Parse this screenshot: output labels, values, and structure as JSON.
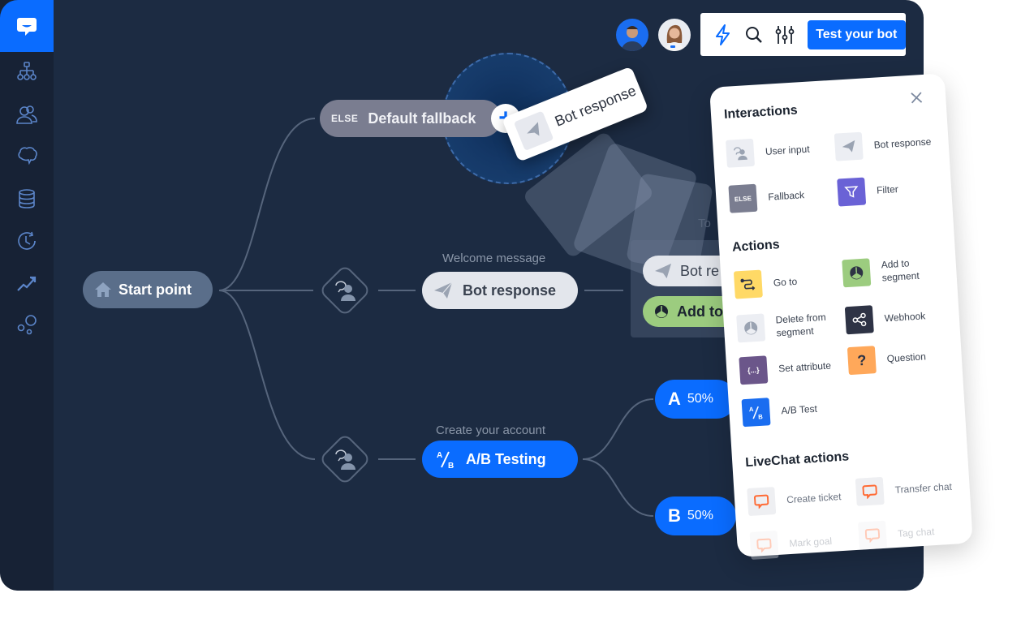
{
  "sidebar": {
    "logo": "chat-logo-icon",
    "items": [
      {
        "icon": "sitemap-icon",
        "label": "Stories"
      },
      {
        "icon": "users-icon",
        "label": "Audience"
      },
      {
        "icon": "brain-icon",
        "label": "Training"
      },
      {
        "icon": "database-icon",
        "label": "Data"
      },
      {
        "icon": "history-icon",
        "label": "History"
      },
      {
        "icon": "trend-icon",
        "label": "Reports"
      },
      {
        "icon": "integrations-icon",
        "label": "Integrations"
      }
    ]
  },
  "toolbar": {
    "avatars": [
      "user-avatar-1",
      "user-avatar-2"
    ],
    "icons": [
      "lightning-icon",
      "search-icon",
      "sliders-icon"
    ],
    "test_label": "Test your bot"
  },
  "flow": {
    "start_label": "Start point",
    "fallback_tag": "ELSE",
    "fallback_label": "Default fallback",
    "welcome_caption": "Welcome message",
    "bot_response_label": "Bot response",
    "create_caption": "Create your account",
    "ab_label": "A/B Testing",
    "ab_a": {
      "letter": "A",
      "percent": "50%"
    },
    "ab_b": {
      "letter": "B",
      "percent": "50%"
    },
    "drag_card_label": "Bot response",
    "to_caption": "To",
    "group_items": [
      "Bot re",
      "Add to"
    ],
    "plus": "+"
  },
  "panel": {
    "interactions_title": "Interactions",
    "interactions": [
      {
        "label": "User input",
        "icon": "user-input-icon",
        "color": "#eceef3"
      },
      {
        "label": "Bot response",
        "icon": "paper-plane-icon",
        "color": "#eceef3"
      },
      {
        "label": "Fallback",
        "icon": "else-icon",
        "tag": "ELSE",
        "color": "#7a7d90"
      },
      {
        "label": "Filter",
        "icon": "filter-icon",
        "color": "#6a62d6"
      }
    ],
    "actions_title": "Actions",
    "actions": [
      {
        "label": "Go to",
        "icon": "goto-icon",
        "color": "#ffd966"
      },
      {
        "label": "Add to segment",
        "icon": "pie-icon",
        "color": "#9ccc7f"
      },
      {
        "label": "Delete from segment",
        "icon": "pie-icon",
        "color": "#eceef3"
      },
      {
        "label": "Webhook",
        "icon": "share-icon",
        "color": "#2e3345"
      },
      {
        "label": "Set attribute",
        "icon": "braces-icon",
        "tag": "{...}",
        "color": "#6b568a"
      },
      {
        "label": "Question",
        "icon": "question-icon",
        "tag": "?",
        "color": "#ffa85a"
      },
      {
        "label": "A/B Test",
        "icon": "ab-icon",
        "color": "#1a6df0"
      }
    ],
    "livechat_title": "LiveChat actions",
    "livechat": [
      {
        "label": "Create ticket",
        "icon": "chat-bubble-icon"
      },
      {
        "label": "Transfer chat",
        "icon": "chat-bubble-icon"
      },
      {
        "label": "Mark goal",
        "icon": "chat-bubble-icon"
      },
      {
        "label": "Tag chat",
        "icon": "chat-bubble-icon"
      }
    ],
    "accent_colors": {
      "brand": "#0a6cff",
      "livechat": "#ff6b35",
      "canvas": "#1c2b42"
    }
  }
}
